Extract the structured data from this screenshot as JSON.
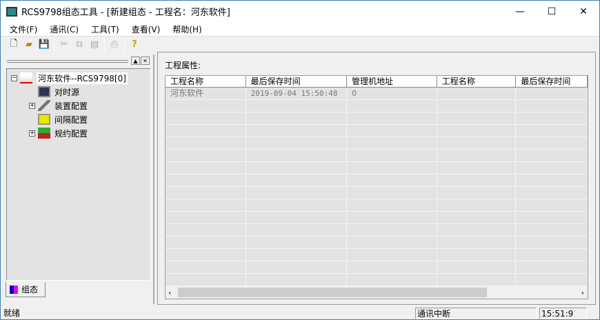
{
  "window": {
    "title": "RCS9798组态工具 - [新建组态 - 工程名：河东软件]",
    "minimize": "—",
    "maximize": "☐",
    "close": "✕"
  },
  "menu": [
    "文件(F)",
    "通讯(C)",
    "工具(T)",
    "查看(V)",
    "帮助(H)"
  ],
  "tree": {
    "root": "河东软件--RCS9798[0]",
    "children": [
      "对时源",
      "装置配置",
      "间隔配置",
      "规约配置"
    ],
    "tab": "组态"
  },
  "main": {
    "props_label": "工程属性:",
    "columns": [
      "工程名称",
      "最后保存时间",
      "管理机地址",
      "工程名称",
      "最后保存时间"
    ],
    "rows": [
      [
        "河东软件",
        "2019-09-04 15:50:48",
        "0",
        "",
        ""
      ]
    ]
  },
  "status": {
    "ready": "就绪",
    "comm": "通讯中断",
    "time": "15:51:9"
  }
}
